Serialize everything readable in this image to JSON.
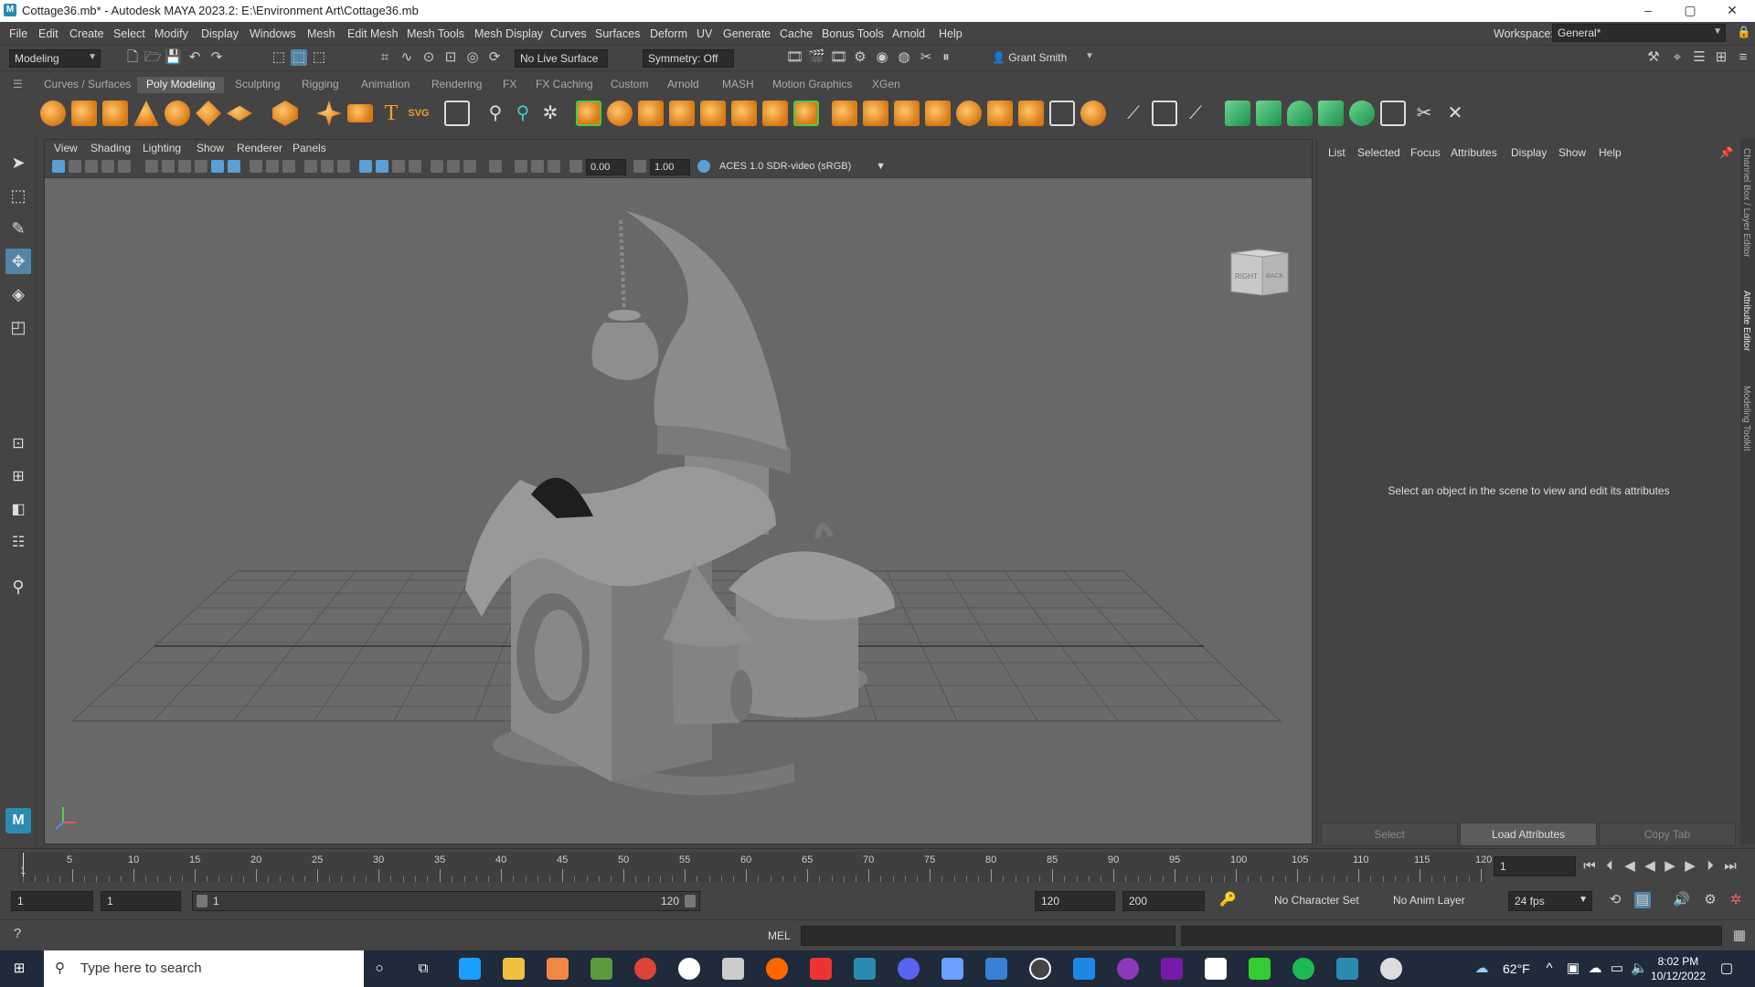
{
  "window": {
    "title": "Cottage36.mb* - Autodesk MAYA 2023.2: E:\\Environment Art\\Cottage36.mb",
    "controls": [
      "–",
      "▢",
      "✕"
    ]
  },
  "menu": [
    "File",
    "Edit",
    "Create",
    "Select",
    "Modify",
    "Display",
    "Windows",
    "Mesh",
    "Edit Mesh",
    "Mesh Tools",
    "Mesh Display",
    "Curves",
    "Surfaces",
    "Deform",
    "UV",
    "Generate",
    "Cache",
    "Bonus Tools",
    "Arnold",
    "Help"
  ],
  "workspace": {
    "label": "Workspace:",
    "value": "General*"
  },
  "statusline": {
    "menuset": "Modeling",
    "live_surface": "No Live Surface",
    "symmetry": "Symmetry: Off",
    "user": "Grant Smith"
  },
  "shelf_tabs": [
    "Curves / Surfaces",
    "Poly Modeling",
    "Sculpting",
    "Rigging",
    "Animation",
    "Rendering",
    "FX",
    "FX Caching",
    "Custom",
    "Arnold",
    "MASH",
    "Motion Graphics",
    "XGen"
  ],
  "shelf_active": "Poly Modeling",
  "viewport": {
    "menu": [
      "View",
      "Shading",
      "Lighting",
      "Show",
      "Renderer",
      "Panels"
    ],
    "field_a": "0.00",
    "field_b": "1.00",
    "colorspace": "ACES 1.0 SDR-video (sRGB)",
    "viewcube": {
      "right": "RIGHT",
      "back": "BACK"
    }
  },
  "attribute_editor": {
    "menu": [
      "List",
      "Selected",
      "Focus",
      "Attributes",
      "Display",
      "Show",
      "Help"
    ],
    "message": "Select an object in the scene to view and edit its attributes",
    "buttons": [
      "Select",
      "Load Attributes",
      "Copy Tab"
    ]
  },
  "side_tabs": [
    "Channel Box / Layer Editor",
    "Attribute Editor",
    "Modeling Toolkit"
  ],
  "timeline": {
    "ticks": [
      "5",
      "10",
      "15",
      "20",
      "25",
      "30",
      "35",
      "40",
      "45",
      "50",
      "55",
      "60",
      "65",
      "70",
      "75",
      "80",
      "85",
      "90",
      "95",
      "100",
      "105",
      "110",
      "115",
      "120"
    ],
    "start_tick": "1",
    "current_frame": "1"
  },
  "range": {
    "start": "1",
    "playback_start": "1",
    "slider_start": "1",
    "slider_end": "120",
    "playback_end": "120",
    "end": "200",
    "character_set": "No Character Set",
    "anim_layer": "No Anim Layer",
    "fps": "24 fps"
  },
  "cmdline": {
    "lang": "MEL"
  },
  "taskbar": {
    "search_placeholder": "Type here to search",
    "weather": "62°F",
    "time": "8:02 PM",
    "date": "10/12/2022"
  }
}
